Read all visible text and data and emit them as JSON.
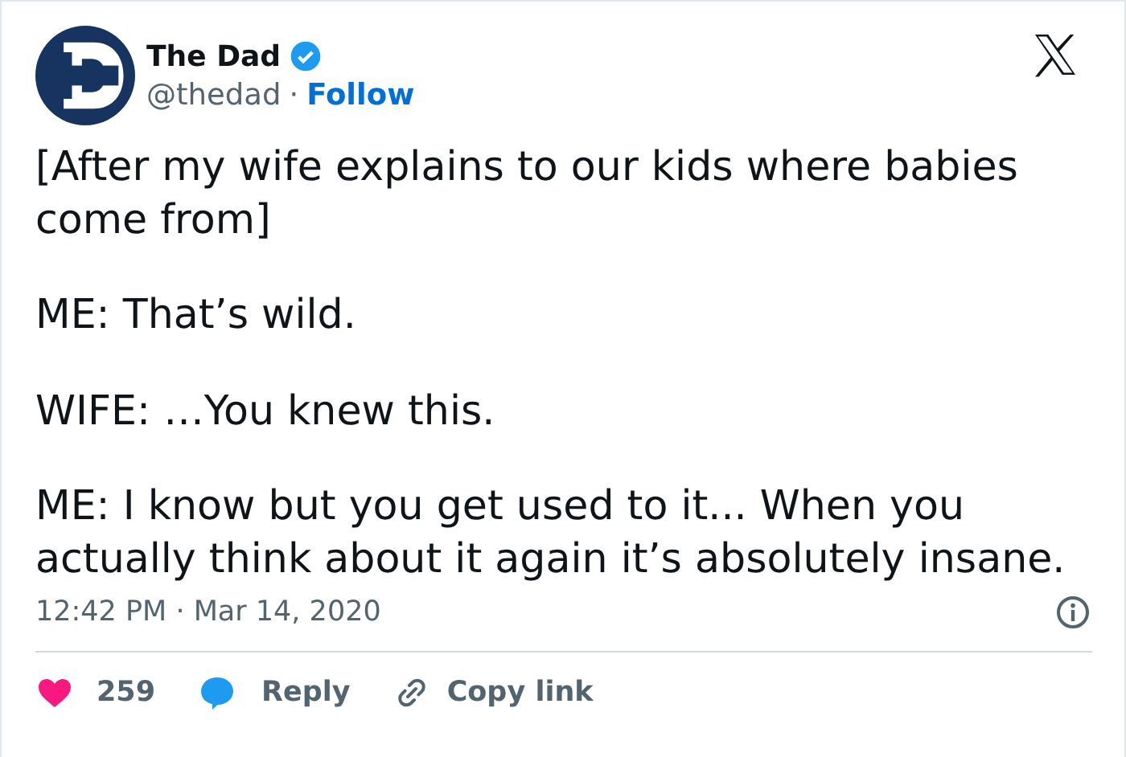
{
  "author": {
    "name": "The Dad",
    "verified": true,
    "handle": "@thedad",
    "separator": "·",
    "follow": "Follow"
  },
  "paragraphs": [
    "[After my wife explains to our kids where babies come from]",
    "ME: That’s wild.",
    "WIFE: …You knew this.",
    "ME: I know but you get used to it... When you actually think about it again it’s absolutely insane."
  ],
  "timestamp": "12:42 PM · Mar 14, 2020",
  "actions": [
    {
      "kind": "like",
      "label": "259"
    },
    {
      "kind": "reply",
      "label": "Reply"
    },
    {
      "kind": "copy",
      "label": "Copy link"
    }
  ]
}
